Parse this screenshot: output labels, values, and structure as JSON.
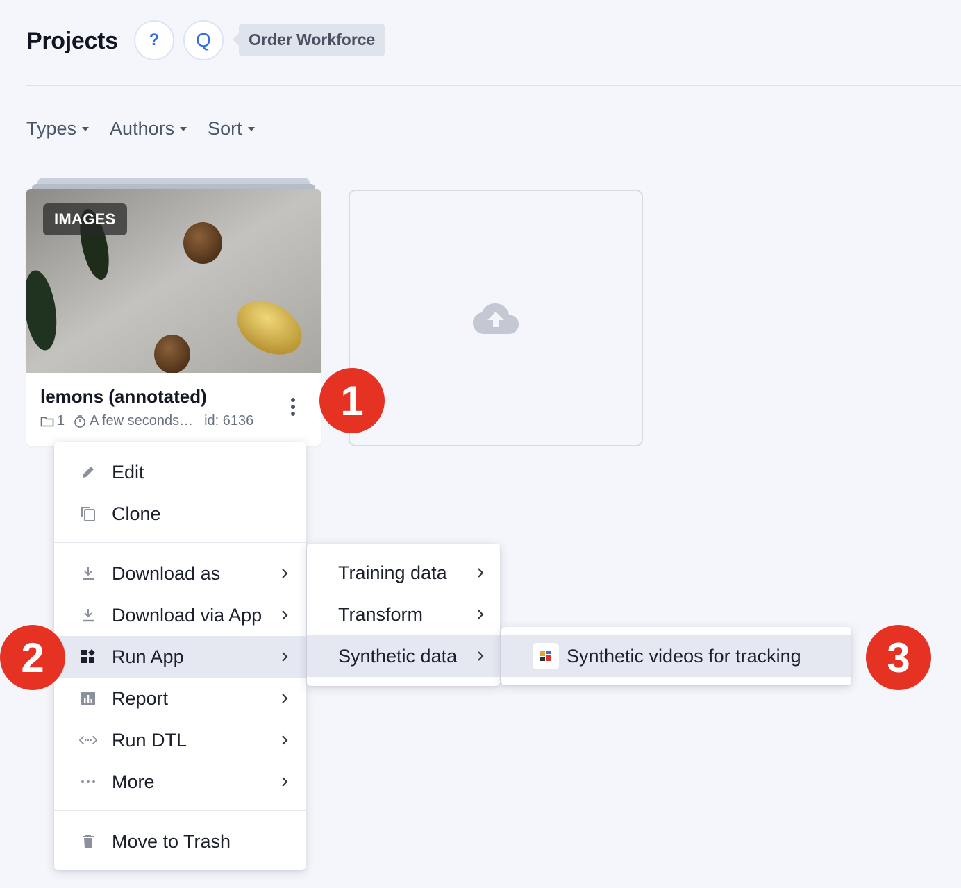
{
  "header": {
    "title": "Projects",
    "help_label": "?",
    "q_label": "Q",
    "order_label": "Order Workforce"
  },
  "filters": [
    {
      "label": "Types"
    },
    {
      "label": "Authors"
    },
    {
      "label": "Sort"
    }
  ],
  "project_card": {
    "type_badge": "IMAGES",
    "title": "lemons (annotated)",
    "datasets_count": "1",
    "time": "A few seconds…",
    "id": "id: 6136"
  },
  "markers": [
    "1",
    "2",
    "3"
  ],
  "context_menu": {
    "items": [
      {
        "label": "Edit",
        "icon": "pencil-icon"
      },
      {
        "label": "Clone",
        "icon": "copy-icon"
      },
      {
        "label": "Download as",
        "icon": "download-icon"
      },
      {
        "label": "Download via App",
        "icon": "download-icon"
      },
      {
        "label": "Run App",
        "icon": "apps-icon"
      },
      {
        "label": "Report",
        "icon": "report-icon"
      },
      {
        "label": "Run DTL",
        "icon": "code-icon"
      },
      {
        "label": "More",
        "icon": "more-icon"
      },
      {
        "label": "Move to Trash",
        "icon": "trash-icon"
      }
    ]
  },
  "run_app_submenu": {
    "items": [
      {
        "label": "Training data"
      },
      {
        "label": "Transform"
      },
      {
        "label": "Synthetic data"
      }
    ]
  },
  "synthetic_submenu": {
    "items": [
      {
        "label": "Synthetic videos for tracking",
        "icon": "app-icon"
      }
    ]
  }
}
